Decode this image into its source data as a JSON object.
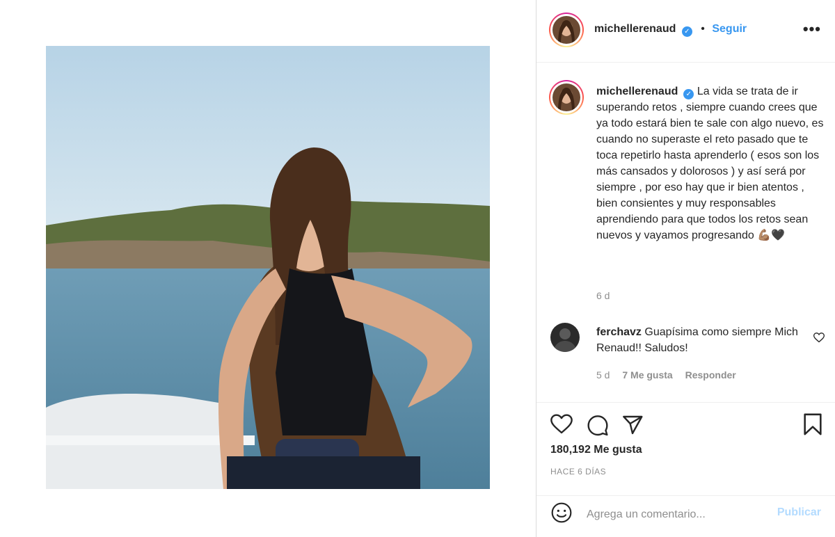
{
  "post": {
    "author": "michellerenaud",
    "follow_label": "Seguir",
    "separator": "•",
    "more_label": "•••",
    "verified_mark": "✓"
  },
  "caption": {
    "author": "michellerenaud",
    "text": "La vida se trata de ir superando retos , siempre cuando crees que ya todo estará bien te sale con algo nuevo, es cuando no superaste el reto pasado que te toca repetirlo hasta aprenderlo ( esos son los más cansados y dolorosos ) y así será por siempre , por eso hay que ir bien atentos , bien consientes y muy responsables aprendiendo para que todos los retos sean nuevos y vayamos progresando",
    "emoji": "💪🏽🖤",
    "time": "6 d"
  },
  "comments": [
    {
      "author": "ferchavz",
      "text": "Guapísima como siempre Mich Renaud!! Saludos!",
      "time": "5 d",
      "likes": "7 Me gusta",
      "reply_label": "Responder"
    }
  ],
  "stats": {
    "likes": "180,192 Me gusta",
    "date": "HACE 6 DÍAS"
  },
  "composer": {
    "placeholder": "Agrega un comentario...",
    "publish_label": "Publicar"
  },
  "icons": {
    "like": "heart-icon",
    "comment": "comment-bubble-icon",
    "share": "paper-plane-icon",
    "save": "bookmark-icon",
    "emoji": "smiley-icon",
    "comment_like": "small-heart-icon",
    "verified": "verified-badge-icon",
    "more": "more-options-icon"
  },
  "colors": {
    "accent_blue": "#3897f0",
    "publish_disabled": "#b3dbff",
    "muted_text": "#8e8e8e",
    "divider": "#dbdbdb"
  }
}
